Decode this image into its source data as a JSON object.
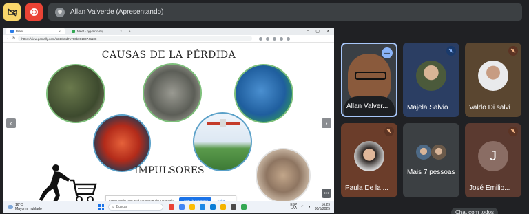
{
  "top_bar": {
    "presenter_label": "Allan Valverde (Apresentando)"
  },
  "browser": {
    "tabs": [
      {
        "label": "Brasil"
      },
      {
        "label": "Meet - pjg-mrfo-rwj"
      }
    ],
    "url": "https://view.genially.com/6248b8d71700b00193741188"
  },
  "slide": {
    "title": "CAUSAS DE LA PÉRDIDA",
    "subtitle": "IMPULSORES"
  },
  "share_notice": {
    "text": "meet.google.com está compartiendo tu pantalla.",
    "stop_label": "Dejar de compartir",
    "hide_label": "Ocultar"
  },
  "taskbar": {
    "weather_temp": "16°C",
    "weather_desc": "Mayorm. nublado",
    "search_placeholder": "Buscar",
    "lang_top": "ESP",
    "lang_bottom": "LAA",
    "time": "16:29",
    "date": "30/5/2025"
  },
  "participants": [
    {
      "name": "Allan Valver..."
    },
    {
      "name": "Majela Salvio"
    },
    {
      "name": "Valdo Di salvi"
    },
    {
      "name": "Paula De la ..."
    },
    {
      "name": "Mais 7 pessoas"
    },
    {
      "name": "José Emilio...",
      "initial": "J"
    }
  ],
  "chat_pill": "Chat com todos",
  "colors": {
    "background": "#202124",
    "cam_off": "#f9d66b",
    "record": "#ea4335",
    "active_speaker_border": "#a8c7fa"
  }
}
